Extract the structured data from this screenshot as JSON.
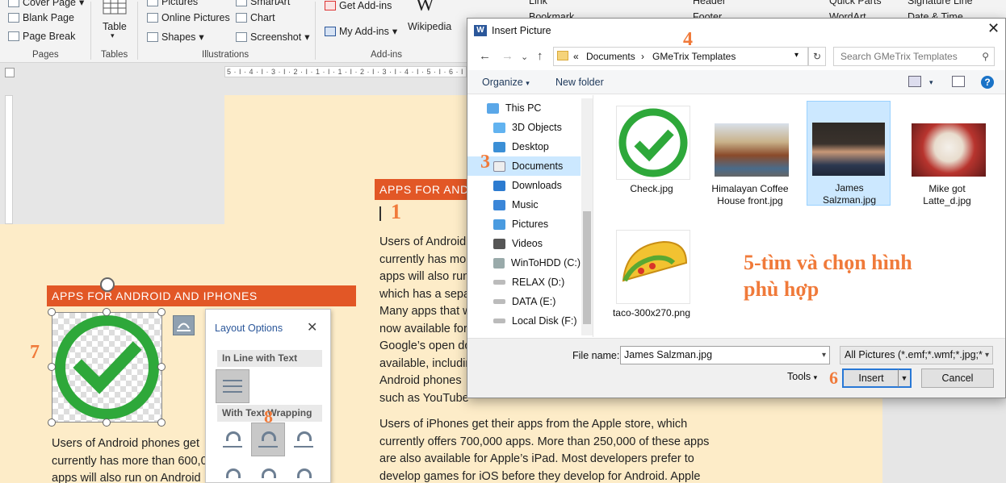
{
  "ribbon": {
    "pages": {
      "cover_page": "Cover Page",
      "blank_page": "Blank Page",
      "page_break": "Page Break",
      "group": "Pages"
    },
    "tables": {
      "table": "Table",
      "group": "Tables"
    },
    "illustrations": {
      "pictures": "Pictures",
      "online_pictures": "Online Pictures",
      "shapes": "Shapes",
      "smartart": "SmartArt",
      "chart": "Chart",
      "screenshot": "Screenshot",
      "group": "Illustrations"
    },
    "addins": {
      "get_addins": "Get Add-ins",
      "my_addins": "My Add-ins",
      "wikipedia": "Wikipedia",
      "group": "Add-ins"
    },
    "partial": {
      "link": "Link",
      "bookmark": "Bookmark",
      "header": "Header",
      "footer": "Footer",
      "quick_parts": "Quick Parts",
      "wordart": "WordArt",
      "signature_line": "Signature Line",
      "date_time": "Date & Time"
    }
  },
  "ruler": {
    "ticks": "5 · I · 4 · I · 3 · I · 2 · I · 1 · I · 1 · I · 2 · I · 3 · I · 4 · I · 5 · I · 6 · I"
  },
  "document": {
    "heading_right": "APPS FOR AND",
    "heading_left": "APPS FOR ANDROID AND IPHONES",
    "para1": "Users of Android\ncurrently has mo\napps will also run\nwhich has a sepa\nMany apps that w\nnow available for\nGoogle’s open do\navailable, includin\nAndroid phones\nsuch as YouTube and Google Docs.",
    "para2": "Users of iPhones get their apps from the Apple store, which\ncurrently offers 700,000 apps. More than 250,000 of these apps\nare also available for Apple’s iPad. Most developers prefer to\ndevelop games for iOS before they develop for Android. Apple",
    "para_left": "Users of Android phones get                               Play,\ncurrently has more than 600,0                            of th\napps will also run on Android                             Kindle"
  },
  "annotations": {
    "s1": "1",
    "s3": "3",
    "s4": "4",
    "s5": "5-tìm và chọn hình\nphù hợp",
    "s6": "6",
    "s7": "7",
    "s8": "8"
  },
  "layout_options": {
    "title": "Layout Options",
    "close": "✕",
    "inline_header": "In Line with Text",
    "wrap_header": "With Text Wrapping"
  },
  "dialog": {
    "title": "Insert Picture",
    "word_icon": "W",
    "close": "✕",
    "address": {
      "sep": "«",
      "crumb1": "Documents",
      "arrow": "›",
      "crumb2": "GMeTrix Templates"
    },
    "search_placeholder": "Search GMeTrix Templates",
    "organize": "Organize",
    "new_folder": "New folder",
    "help": "?",
    "nav": [
      "This PC",
      "3D Objects",
      "Desktop",
      "Documents",
      "Downloads",
      "Music",
      "Pictures",
      "Videos",
      "WinToHDD (C:)",
      "RELAX (D:)",
      "DATA (E:)",
      "Local Disk (F:)"
    ],
    "files": [
      "Check.jpg",
      "Himalayan Coffee House front.jpg",
      "James Salzman.jpg",
      "Mike got Latte_d.jpg",
      "taco-300x270.png"
    ],
    "file_name_label": "File name:",
    "file_name_value": "James Salzman.jpg",
    "filter": "All Pictures (*.emf;*.wmf;*.jpg;*",
    "tools": "Tools",
    "insert": "Insert",
    "cancel": "Cancel"
  },
  "colors": {
    "accent": "#e25726",
    "annotation": "#f07a3a",
    "page": "#fdecc8",
    "selection": "#cce8ff",
    "check_green": "#2ea83a"
  }
}
